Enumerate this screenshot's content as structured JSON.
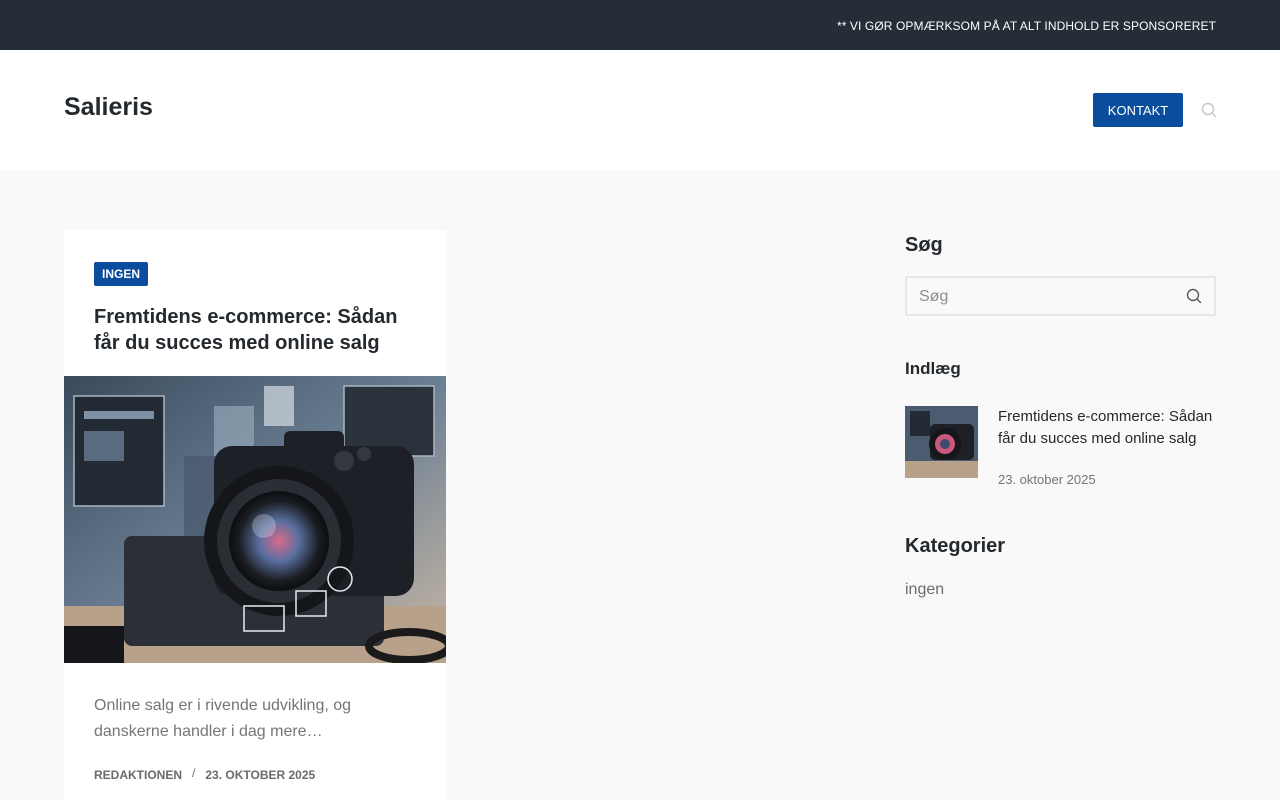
{
  "topbar": {
    "notice": "** VI GØR OPMÆRKSOM PÅ AT ALT INDHOLD ER SPONSORERET"
  },
  "header": {
    "site_title": "Salieris",
    "contact_label": "KONTAKT",
    "search_icon": "search-icon"
  },
  "article": {
    "category": "INGEN",
    "title": "Fremtidens e-commerce: Sådan får du succes med online salg",
    "image_icon": "camera-image",
    "excerpt": "Online salg er i rivende udvikling, og danskerne handler i dag mere…",
    "author": "REDAKTIONEN",
    "separator": "/",
    "date": "23. OKTOBER 2025"
  },
  "sidebar": {
    "search": {
      "title": "Søg",
      "placeholder": "Søg"
    },
    "posts": {
      "title": "Indlæg",
      "items": [
        {
          "title": "Fremtidens e-commerce: Sådan får du succes med online salg",
          "date": "23. oktober 2025"
        }
      ]
    },
    "categories": {
      "title": "Kategorier",
      "items": [
        "ingen"
      ]
    }
  },
  "colors": {
    "accent": "#0b4d9d",
    "topbar": "#252d36",
    "background": "#f9f9f9"
  }
}
